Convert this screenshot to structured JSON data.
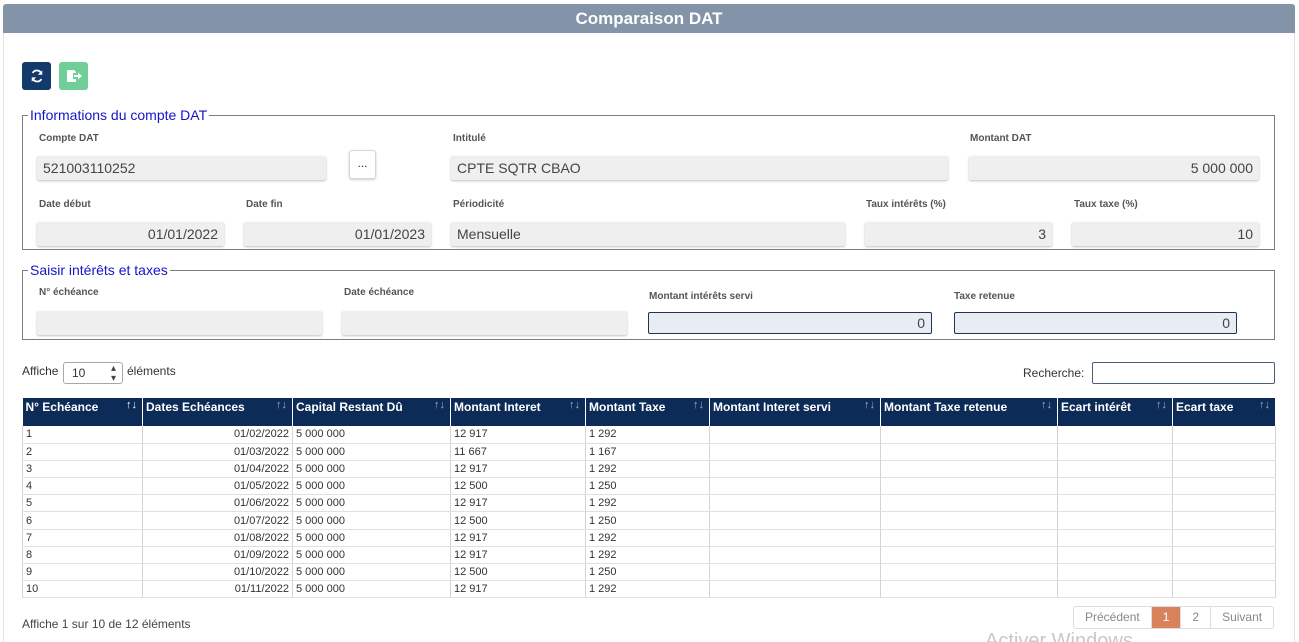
{
  "window": {
    "title": "Comparaison DAT"
  },
  "toolbar": {
    "refresh_icon": "refresh-icon",
    "export_icon": "export-icon"
  },
  "compte": {
    "legend": "Informations du compte DAT",
    "compte_label": "Compte DAT",
    "compte_value": "521003110252",
    "lookup_label": "...",
    "intitule_label": "Intitulé",
    "intitule_value": "CPTE SQTR CBAO",
    "montant_label": "Montant DAT",
    "montant_value": "5 000 000",
    "date_debut_label": "Date début",
    "date_debut_value": "01/01/2022",
    "date_fin_label": "Date fin",
    "date_fin_value": "01/01/2023",
    "periodicite_label": "Périodicité",
    "periodicite_value": "Mensuelle",
    "taux_interets_label": "Taux intérêts (%)",
    "taux_interets_value": "3",
    "taux_taxe_label": "Taux taxe (%)",
    "taux_taxe_value": "10"
  },
  "saisie": {
    "legend": "Saisir intérêts et taxes",
    "echeance_label": "N° échéance",
    "echeance_value": "",
    "date_label": "Date échéance",
    "date_value": "",
    "montant_servi_label": "Montant intérêts servi",
    "montant_servi_value": "0",
    "taxe_label": "Taxe retenue",
    "taxe_value": "0"
  },
  "table_controls": {
    "show_label": "Affiche",
    "page_length": "10",
    "elements_label": "éléments",
    "search_label": "Recherche:",
    "search_value": ""
  },
  "table": {
    "columns": [
      "N° Echéance",
      "Dates Echéances",
      "Capital Restant Dû",
      "Montant Interet",
      "Montant Taxe",
      "Montant Interet servi",
      "Montant Taxe retenue",
      "Ecart intérêt",
      "Ecart taxe"
    ],
    "rows": [
      [
        "1",
        "01/02/2022",
        "5 000 000",
        "12 917",
        "1 292",
        "",
        "",
        "",
        ""
      ],
      [
        "2",
        "01/03/2022",
        "5 000 000",
        "11 667",
        "1 167",
        "",
        "",
        "",
        ""
      ],
      [
        "3",
        "01/04/2022",
        "5 000 000",
        "12 917",
        "1 292",
        "",
        "",
        "",
        ""
      ],
      [
        "4",
        "01/05/2022",
        "5 000 000",
        "12 500",
        "1 250",
        "",
        "",
        "",
        ""
      ],
      [
        "5",
        "01/06/2022",
        "5 000 000",
        "12 917",
        "1 292",
        "",
        "",
        "",
        ""
      ],
      [
        "6",
        "01/07/2022",
        "5 000 000",
        "12 500",
        "1 250",
        "",
        "",
        "",
        ""
      ],
      [
        "7",
        "01/08/2022",
        "5 000 000",
        "12 917",
        "1 292",
        "",
        "",
        "",
        ""
      ],
      [
        "8",
        "01/09/2022",
        "5 000 000",
        "12 917",
        "1 292",
        "",
        "",
        "",
        ""
      ],
      [
        "9",
        "01/10/2022",
        "5 000 000",
        "12 500",
        "1 250",
        "",
        "",
        "",
        ""
      ],
      [
        "10",
        "01/11/2022",
        "5 000 000",
        "12 917",
        "1 292",
        "",
        "",
        "",
        ""
      ]
    ]
  },
  "footer": {
    "info": "Affiche 1 sur 10 de 12 éléments",
    "prev": "Précédent",
    "page1": "1",
    "page2": "2",
    "next": "Suivant",
    "watermark": "Activer Windows"
  },
  "colors": {
    "header_bar": "#8393a8",
    "table_header": "#0d2b57",
    "legend": "#1515c8",
    "current_page": "#d9835d",
    "export_button": "#6fcf97",
    "refresh_button": "#143a6b"
  }
}
